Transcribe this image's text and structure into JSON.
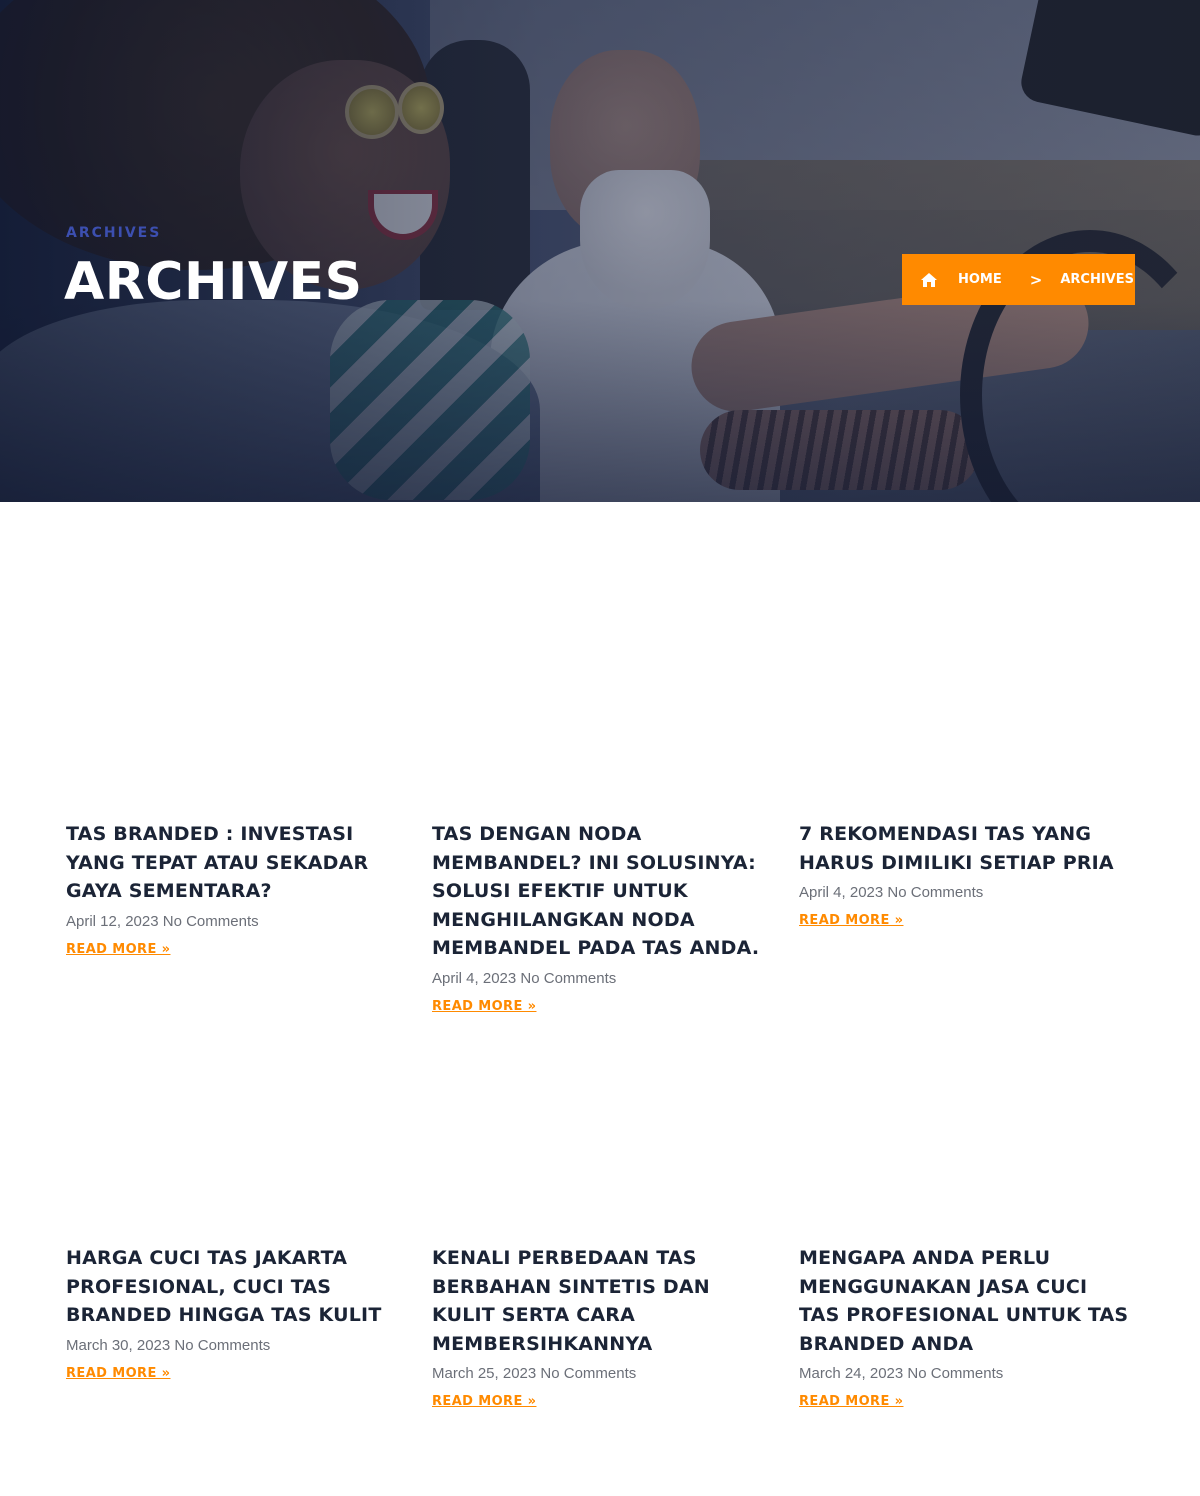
{
  "hero": {
    "subtitle": "ARCHIVES",
    "title": "ARCHIVES"
  },
  "breadcrumb": {
    "home_icon": "home-icon",
    "home_label": "HOME",
    "separator": ">",
    "current_label": "ARCHIVES",
    "background_color": "#ff8a00"
  },
  "posts": [
    {
      "title": "TAS BRANDED : INVESTASI YANG TEPAT ATAU SEKADAR GAYA SEMENTARA?",
      "date": "April 12, 2023",
      "comments": "No Comments",
      "read_more": "READ MORE »"
    },
    {
      "title": "TAS DENGAN NODA MEMBANDEL? INI SOLUSINYA: SOLUSI EFEKTIF UNTUK MENGHILANGKAN NODA MEMBANDEL PADA TAS ANDA.",
      "date": "April 4, 2023",
      "comments": "No Comments",
      "read_more": "READ MORE »"
    },
    {
      "title": "7 REKOMENDASI TAS YANG HARUS DIMILIKI SETIAP PRIA",
      "date": "April 4, 2023",
      "comments": "No Comments",
      "read_more": "READ MORE »"
    },
    {
      "title": "HARGA CUCI TAS JAKARTA PROFESIONAL, CUCI TAS BRANDED HINGGA TAS KULIT",
      "date": "March 30, 2023",
      "comments": "No Comments",
      "read_more": "READ MORE »"
    },
    {
      "title": "KENALI PERBEDAAN TAS BERBAHAN SINTETIS DAN KULIT SERTA CARA MEMBERSIHKANNYA",
      "date": "March 25, 2023",
      "comments": "No Comments",
      "read_more": "READ MORE »"
    },
    {
      "title": "MENGAPA ANDA PERLU MENGGUNAKAN JASA CUCI TAS PROFESIONAL UNTUK TAS BRANDED ANDA",
      "date": "March 24, 2023",
      "comments": "No Comments",
      "read_more": "READ MORE »"
    }
  ],
  "colors": {
    "accent": "#ff8a00",
    "heading": "#1b2436",
    "meta": "#6b6f78",
    "hero_subtitle": "#3c4fb0"
  }
}
